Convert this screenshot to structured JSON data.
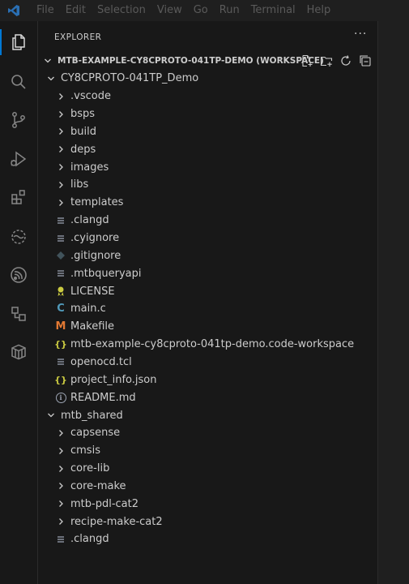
{
  "menu": [
    "File",
    "Edit",
    "Selection",
    "View",
    "Go",
    "Run",
    "Terminal",
    "Help"
  ],
  "explorer": {
    "header": "EXPLORER",
    "more": "···",
    "workspace_title": "MTB-EXAMPLE-CY8CPROTO-041TP-DEMO (WORKSPACE)"
  },
  "tree": [
    {
      "label": "CY8CPROTO-041TP_Demo",
      "indent": 1,
      "kind": "folder-open"
    },
    {
      "label": ".vscode",
      "indent": 2,
      "kind": "folder"
    },
    {
      "label": "bsps",
      "indent": 2,
      "kind": "folder"
    },
    {
      "label": "build",
      "indent": 2,
      "kind": "folder"
    },
    {
      "label": "deps",
      "indent": 2,
      "kind": "folder"
    },
    {
      "label": "images",
      "indent": 2,
      "kind": "folder"
    },
    {
      "label": "libs",
      "indent": 2,
      "kind": "folder"
    },
    {
      "label": "templates",
      "indent": 2,
      "kind": "folder"
    },
    {
      "label": ".clangd",
      "indent": 2,
      "kind": "file-lines"
    },
    {
      "label": ".cyignore",
      "indent": 2,
      "kind": "file-lines"
    },
    {
      "label": ".gitignore",
      "indent": 2,
      "kind": "git"
    },
    {
      "label": ".mtbqueryapi",
      "indent": 2,
      "kind": "file-lines"
    },
    {
      "label": "LICENSE",
      "indent": 2,
      "kind": "license"
    },
    {
      "label": "main.c",
      "indent": 2,
      "kind": "c"
    },
    {
      "label": "Makefile",
      "indent": 2,
      "kind": "makefile"
    },
    {
      "label": "mtb-example-cy8cproto-041tp-demo.code-workspace",
      "indent": 2,
      "kind": "json"
    },
    {
      "label": "openocd.tcl",
      "indent": 2,
      "kind": "file-lines"
    },
    {
      "label": "project_info.json",
      "indent": 2,
      "kind": "json"
    },
    {
      "label": "README.md",
      "indent": 2,
      "kind": "info"
    },
    {
      "label": "mtb_shared",
      "indent": 1,
      "kind": "folder-open"
    },
    {
      "label": "capsense",
      "indent": 2,
      "kind": "folder"
    },
    {
      "label": "cmsis",
      "indent": 2,
      "kind": "folder"
    },
    {
      "label": "core-lib",
      "indent": 2,
      "kind": "folder"
    },
    {
      "label": "core-make",
      "indent": 2,
      "kind": "folder"
    },
    {
      "label": "mtb-pdl-cat2",
      "indent": 2,
      "kind": "folder"
    },
    {
      "label": "recipe-make-cat2",
      "indent": 2,
      "kind": "folder"
    },
    {
      "label": ".clangd",
      "indent": 2,
      "kind": "file-lines"
    }
  ],
  "icons": {
    "json_brace": "{}",
    "c_letter": "C",
    "makefile_letter": "M",
    "info_letter": "i"
  },
  "colors": {
    "accent": "#0078d4",
    "json": "#cbcb41",
    "c": "#519aba",
    "makefile": "#e37933",
    "license": "#cbcb41",
    "git": "#41535b"
  }
}
